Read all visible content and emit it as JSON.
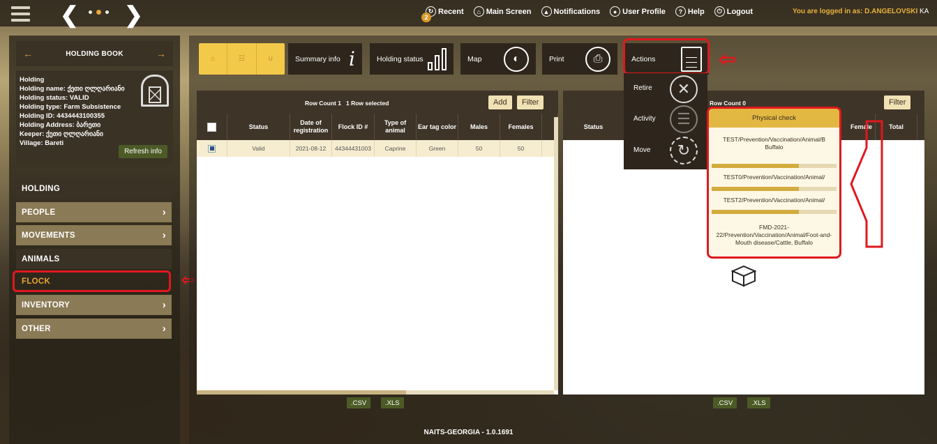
{
  "topbar": {
    "recent_label": "Recent",
    "recent_badge": "2",
    "main_screen_label": "Main Screen",
    "notifications_label": "Notifications",
    "user_profile_label": "User Profile",
    "help_label": "Help",
    "logout_label": "Logout",
    "logged_in_text": "You are logged in as: D.ANGELOVSKI",
    "language": "KA"
  },
  "holding_book": {
    "title": "HOLDING BOOK",
    "info": [
      "Holding",
      "Holding name: ქეთი ღლღარიანი",
      "Holding status: VALID",
      "Holding type: Farm Subsistence",
      "Holding ID: 4434443100355",
      "Holding Address: ბარეთი",
      "Keeper: ქეთი ღლღარიანი",
      "Village: Bareti"
    ],
    "refresh_label": "Refresh info"
  },
  "menu": {
    "holding": "HOLDING",
    "people": "PEOPLE",
    "movements": "MOVEMENTS",
    "animals": "ANIMALS",
    "flock": "FLOCK",
    "inventory": "INVENTORY",
    "other": "OTHER"
  },
  "toolbar": {
    "summary_info": "Summary info",
    "holding_status": "Holding status",
    "map": "Map",
    "print": "Print",
    "actions": "Actions"
  },
  "actions_menu": {
    "retire": "Retire",
    "activity": "Activity",
    "move": "Move"
  },
  "left_grid": {
    "row_count": "Row Count 1",
    "selected": "1 Row selected",
    "add_label": "Add",
    "filter_label": "Filter",
    "columns": [
      "Status",
      "Date of registration",
      "Flock ID #",
      "Type of animal",
      "Ear tag color",
      "Males",
      "Females"
    ],
    "rows": [
      [
        "Valid",
        "2021-08-12",
        "44344431003",
        "Caprine",
        "Green",
        "50",
        "50"
      ]
    ],
    "csv_label": ".CSV",
    "xls_label": ".XLS"
  },
  "right_grid": {
    "row_count": "Row Count 0",
    "filter_label": "Filter",
    "columns": [
      "Status",
      "registration",
      "Female",
      "Total"
    ],
    "csv_label": ".CSV",
    "xls_label": ".XLS"
  },
  "physical_check": {
    "title": "Physical check",
    "items": [
      {
        "text": "TEST/Prevention/Vaccination/Animal/B Buffalo",
        "progress": 0.7
      },
      {
        "text": "TEST0/Prevention/Vaccination/Animal/",
        "progress": 0.7
      },
      {
        "text": "TEST2/Prevention/Vaccination/Animal/",
        "progress": 0.7
      },
      {
        "text": "FMD-2021-22/Prevention/Vaccination/Animal/Foot-and-Mouth disease/Cattle, Buffalo",
        "progress": 0
      }
    ]
  },
  "footer": "NAITS-GEORGIA - 1.0.1691"
}
